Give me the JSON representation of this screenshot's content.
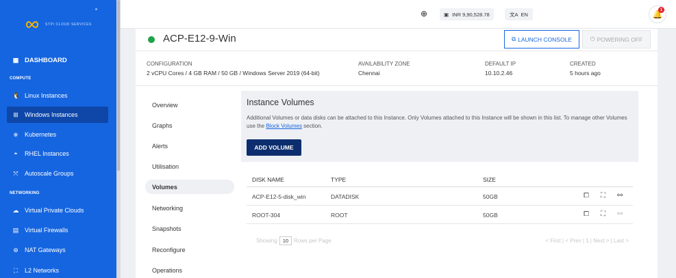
{
  "sidebar": {
    "brand_text": "STPI CLOUD SERVICES",
    "dashboard": "DASHBOARD",
    "sections": {
      "compute": "COMPUTE",
      "networking": "NETWORKING"
    },
    "compute_items": [
      {
        "label": "Linux Instances",
        "icon": "linux-icon"
      },
      {
        "label": "Windows Instances",
        "icon": "windows-icon",
        "active": true
      },
      {
        "label": "Kubernetes",
        "icon": "kubernetes-icon"
      },
      {
        "label": "RHEL Instances",
        "icon": "rhel-icon"
      },
      {
        "label": "Autoscale Groups",
        "icon": "autoscale-icon"
      }
    ],
    "networking_items": [
      {
        "label": "Virtual Private Clouds",
        "icon": "vpc-icon"
      },
      {
        "label": "Virtual Firewalls",
        "icon": "firewall-icon"
      },
      {
        "label": "NAT Gateways",
        "icon": "nat-icon"
      },
      {
        "label": "L2 Networks",
        "icon": "l2-network-icon"
      }
    ]
  },
  "topbar": {
    "wallet": "INR 9,90,528.78",
    "language": "EN",
    "notification_count": "1"
  },
  "instance": {
    "name": "ACP-E12-9-Win",
    "status_color": "#1fa34a",
    "launch_console": "LAUNCH CONSOLE",
    "powering_off": "POWERING OFF",
    "meta": {
      "configuration_label": "CONFIGURATION",
      "configuration": "2 vCPU Cores / 4 GB RAM / 50 GB / Windows Server 2019 (64-bit)",
      "zone_label": "AVAILABILITY ZONE",
      "zone": "Chennai",
      "ip_label": "DEFAULT IP",
      "ip": "10.10.2.46",
      "created_label": "CREATED",
      "created": "5 hours ago"
    }
  },
  "subnav": [
    "Overview",
    "Graphs",
    "Alerts",
    "Utilisation",
    "Volumes",
    "Networking",
    "Snapshots",
    "Reconfigure",
    "Operations"
  ],
  "volumes": {
    "title": "Instance Volumes",
    "desc_part1": "Additional Volumes or data disks can be attached to this Instance. Only Volumes attached to this Instance will be shown in this list. To manage other Volumes use the ",
    "desc_link": "Block Volumes",
    "desc_part2": " section.",
    "add_button": "ADD VOLUME",
    "columns": [
      "DISK NAME",
      "TYPE",
      "SIZE"
    ],
    "rows": [
      {
        "name": "ACP-E12-5-disk_win",
        "type": "DATADISK",
        "size": "50GB"
      },
      {
        "name": "ROOT-304",
        "type": "ROOT",
        "size": "50GB"
      }
    ],
    "pager": {
      "showing": "Showing",
      "rows_value": "10",
      "rows_per_page": "Rows per Page",
      "nav": "< First | < Prev | 1 | Next > | Last >"
    }
  },
  "colors": {
    "sidebar": "#1565e0",
    "accent": "#1565e0",
    "primary_button": "#0d2e6e"
  }
}
